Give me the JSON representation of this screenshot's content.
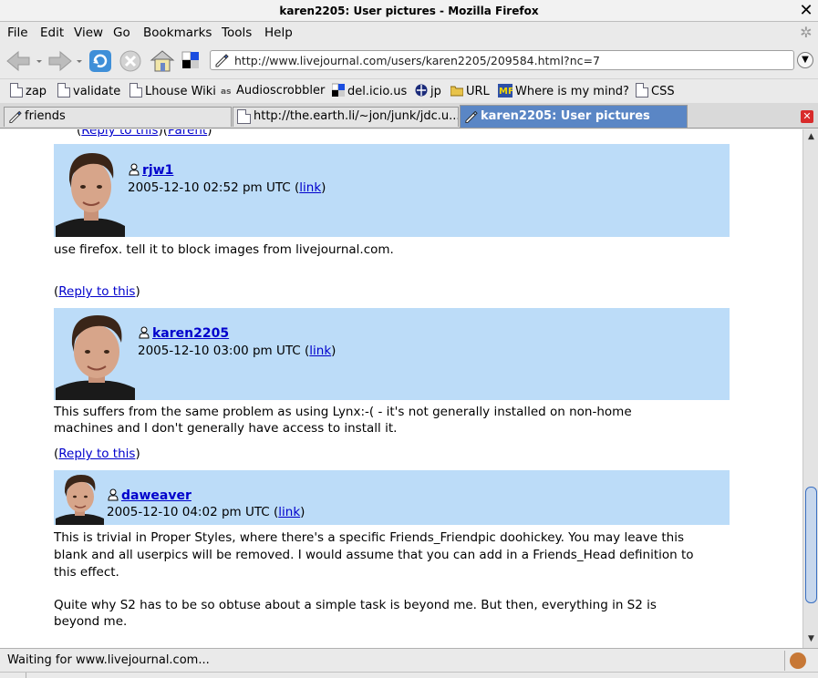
{
  "window": {
    "title": "karen2205: User pictures - Mozilla Firefox"
  },
  "menu": [
    "File",
    "Edit",
    "View",
    "Go",
    "Bookmarks",
    "Tools",
    "Help"
  ],
  "navbar": {
    "url": "http://www.livejournal.com/users/karen2205/209584.html?nc=7"
  },
  "bookmarks": [
    "zap",
    "validate",
    "Lhouse Wiki",
    "Audioscrobbler",
    "del.icio.us",
    "jp",
    "URL",
    "Where is my mind?",
    "CSS"
  ],
  "tabs": [
    "friends",
    "http://the.earth.li/~jon/junk/jdc.u...",
    "karen2205: User pictures"
  ],
  "top_links": {
    "reply": "Reply to this",
    "parent": "Parent"
  },
  "comments": [
    {
      "username": "rjw1",
      "timestamp": "2005-12-10 02:52 pm UTC (",
      "link_label": "link",
      "close": ")",
      "body": [
        "use firefox. tell it to block images from livejournal.com."
      ],
      "reply_label": "Reply to this"
    },
    {
      "username": "karen2205",
      "timestamp": "2005-12-10 03:00 pm UTC (",
      "link_label": "link",
      "close": ")",
      "body": [
        "This suffers from the same problem as using Lynx:-( - it's not generally installed on non-home",
        "machines and I don't generally have access to install it."
      ],
      "reply_label": "Reply to this"
    },
    {
      "username": "daweaver",
      "timestamp": "2005-12-10 04:02 pm UTC (",
      "link_label": "link",
      "close": ")",
      "body": [
        "This is trivial in Proper Styles, where there's a specific Friends_Friendpic doohickey. You may leave this",
        "blank and all userpics will be removed. I would assume that you can add in a Friends_Head definition to",
        "this effect.",
        "Quite why S2 has to be so obtuse about a simple task is beyond me. But then, everything in S2 is",
        "beyond me."
      ]
    }
  ],
  "status": {
    "text": "Waiting for www.livejournal.com..."
  },
  "colors": {
    "comment_header_bg": "#bcdcf8",
    "link": "#0000cc",
    "active_tab": "#5a86c5"
  }
}
